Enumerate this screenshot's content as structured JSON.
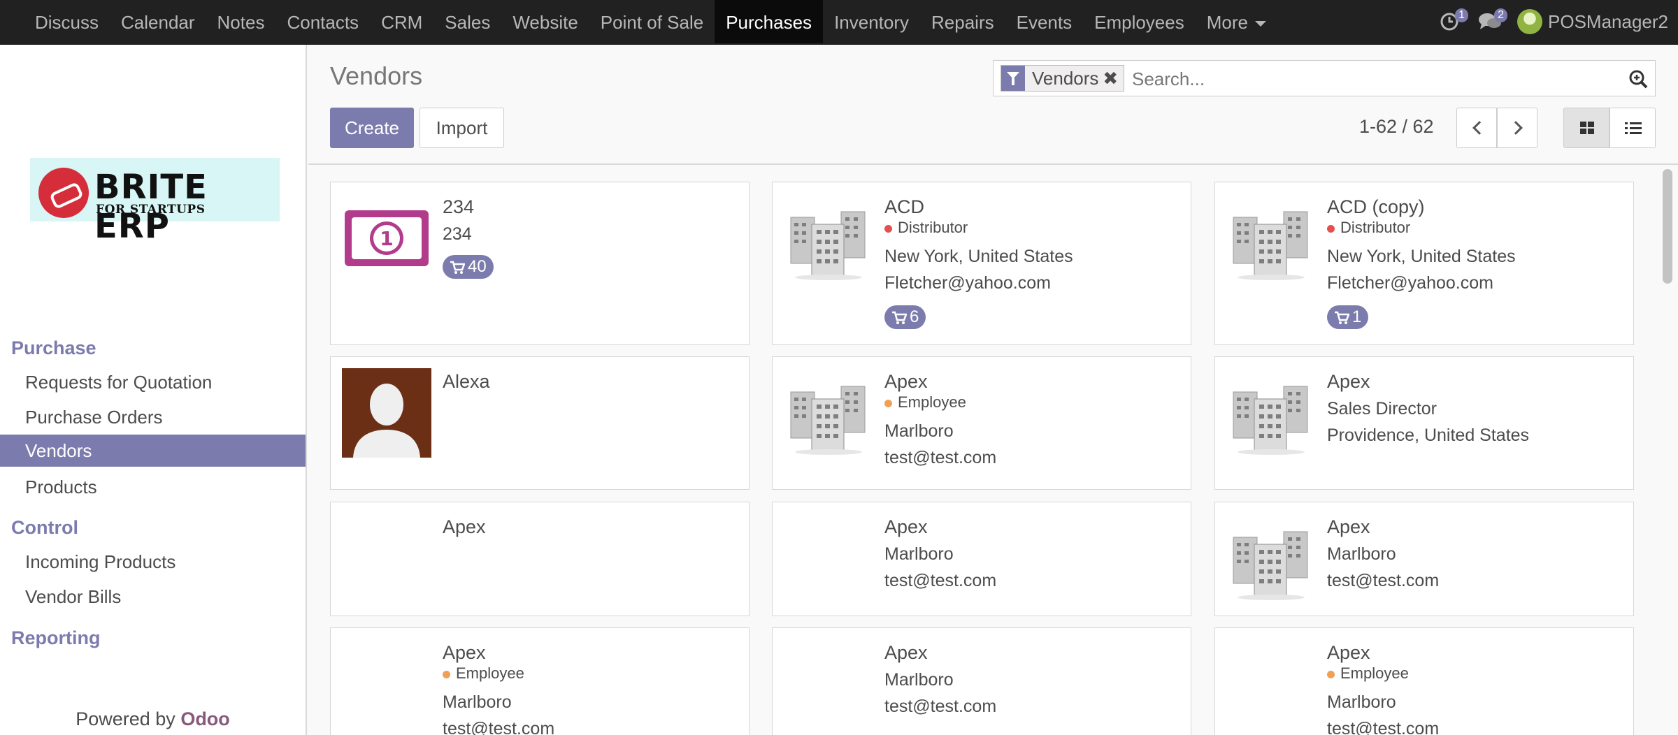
{
  "topbar": {
    "menu": [
      "Discuss",
      "Calendar",
      "Notes",
      "Contacts",
      "CRM",
      "Sales",
      "Website",
      "Point of Sale",
      "Purchases",
      "Inventory",
      "Repairs",
      "Events",
      "Employees",
      "More"
    ],
    "active": "Purchases",
    "activity_count": "1",
    "message_count": "2",
    "user": "POSManager2"
  },
  "logo": {
    "main": "BRITE ERP",
    "sub": "FOR STARTUPS"
  },
  "sidebar": {
    "purchase_title": "Purchase",
    "purchase_items": [
      "Requests for Quotation",
      "Purchase Orders",
      "Vendors",
      "Products"
    ],
    "active_item": "Vendors",
    "control_title": "Control",
    "control_items": [
      "Incoming Products",
      "Vendor Bills"
    ],
    "reporting_title": "Reporting",
    "powered_prefix": "Powered by",
    "powered_brand": "Odoo"
  },
  "control_panel": {
    "title": "Vendors",
    "create_label": "Create",
    "import_label": "Import",
    "facet": "Vendors",
    "facet_remove": "✖",
    "search_placeholder": "Search...",
    "pager": "1-62 / 62"
  },
  "colors": {
    "brand": "#7c7bad",
    "distributor_dot": "#e54f4f",
    "employee_dot": "#f0a055",
    "navbar": "#212121"
  },
  "cards": [
    {
      "name": "234",
      "image": "banknote-icon",
      "lines": [
        "234"
      ],
      "po_count": "40"
    },
    {
      "name": "ACD",
      "image": "company-building-icon",
      "tag": "Distributor",
      "tag_color": "#e54f4f",
      "lines": [
        "New York, United States",
        "Fletcher@yahoo.com"
      ],
      "po_count": "6"
    },
    {
      "name": "ACD (copy)",
      "image": "company-building-icon",
      "tag": "Distributor",
      "tag_color": "#e54f4f",
      "lines": [
        "New York, United States",
        "Fletcher@yahoo.com"
      ],
      "po_count": "1"
    },
    {
      "name": "Alexa",
      "image": "person-avatar",
      "lines": []
    },
    {
      "name": "Apex",
      "image": "company-building-icon",
      "tag": "Employee",
      "tag_color": "#f0a055",
      "lines": [
        "Marlboro",
        "test@test.com"
      ]
    },
    {
      "name": "Apex",
      "image": "company-building-icon",
      "lines": [
        "Sales Director",
        "Providence, United States"
      ]
    },
    {
      "name": "Apex",
      "image": "",
      "lines": []
    },
    {
      "name": "Apex",
      "image": "",
      "lines": [
        "Marlboro",
        "test@test.com"
      ]
    },
    {
      "name": "Apex",
      "image": "company-building-icon",
      "lines": [
        "Marlboro",
        "test@test.com"
      ]
    },
    {
      "name": "Apex",
      "image": "",
      "tag": "Employee",
      "tag_color": "#f0a055",
      "lines": [
        "Marlboro",
        "test@test.com"
      ]
    },
    {
      "name": "Apex",
      "image": "",
      "lines": [
        "Marlboro",
        "test@test.com"
      ]
    },
    {
      "name": "Apex",
      "image": "",
      "tag": "Employee",
      "tag_color": "#f0a055",
      "lines": [
        "Marlboro",
        "test@test.com"
      ]
    }
  ]
}
